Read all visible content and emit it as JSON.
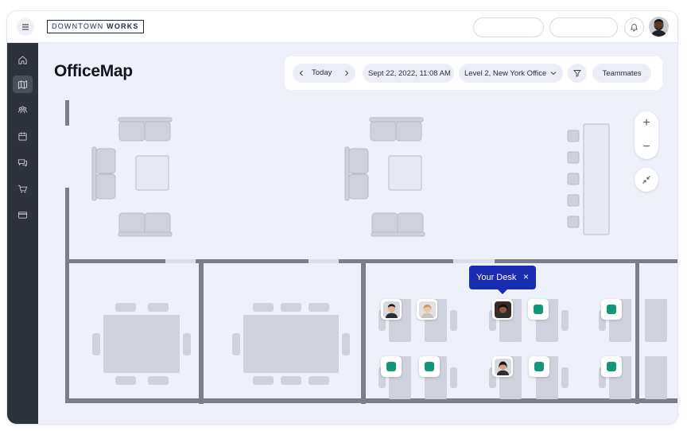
{
  "brand": {
    "logo_light": "DOWNTOWN",
    "logo_bold": "WORKS"
  },
  "header": {
    "title": "OfficeMap"
  },
  "toolbar": {
    "date_label": "Today",
    "datetime": "Sept 22, 2022, 11:08 AM",
    "location": "Level 2, New York Office",
    "teammates_label": "Teammates"
  },
  "sidebar": {
    "items": [
      {
        "icon": "home-icon",
        "active": false
      },
      {
        "icon": "map-icon",
        "active": true
      },
      {
        "icon": "people-icon",
        "active": false
      },
      {
        "icon": "calendar-icon",
        "active": false
      },
      {
        "icon": "chat-icon",
        "active": false
      },
      {
        "icon": "cart-icon",
        "active": false
      },
      {
        "icon": "card-icon",
        "active": false
      }
    ]
  },
  "map": {
    "tooltip_label": "Your Desk",
    "tooltip_close": "×",
    "zoom_in": "+",
    "zoom_out": "−"
  },
  "colors": {
    "accent": "#1a2cb0",
    "available_desk": "#12977a",
    "rail": "#2e323b",
    "floor": "#eef0fa",
    "walls": "#7c7f88"
  }
}
